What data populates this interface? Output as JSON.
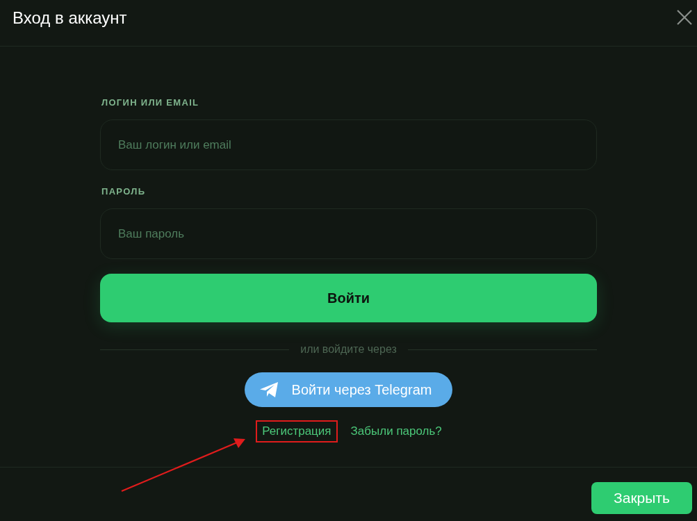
{
  "dialog": {
    "title": "Вход в аккаунт"
  },
  "form": {
    "fields": [
      {
        "label": "ЛОГИН ИЛИ EMAIL",
        "placeholder": "Ваш логин или email"
      },
      {
        "label": "ПАРОЛЬ",
        "placeholder": "Ваш пароль"
      }
    ],
    "submit_button": "Войти",
    "divider_text": "или войдите через",
    "telegram_button": "Войти через Telegram",
    "links": [
      {
        "label": "Регистрация",
        "highlighted": true
      },
      {
        "label": "Забыли пароль?",
        "highlighted": false
      }
    ]
  },
  "footer": {
    "close_button": "Закрыть"
  }
}
